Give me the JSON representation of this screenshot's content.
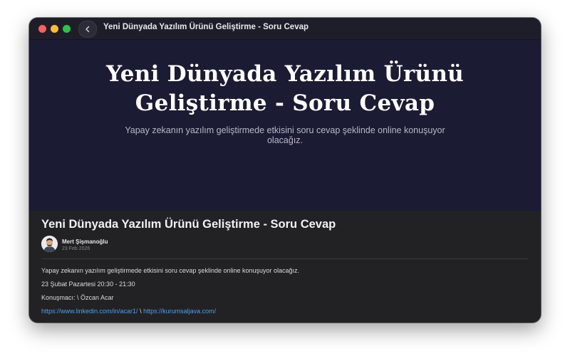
{
  "window": {
    "title": "Yeni Dünyada Yazılım Ürünü Geliştirme - Soru Cevap"
  },
  "hero": {
    "title_line1": "Yeni Dünyada Yazılım Ürünü",
    "title_line2": "Geliştirme - Soru Cevap",
    "subtitle": "Yapay zekanın yazılım geliştirmede etkisini soru cevap şeklinde online konuşuyor olacağız."
  },
  "post": {
    "title": "Yeni Dünyada Yazılım Ürünü Geliştirme - Soru Cevap",
    "author": "Mert Şişmanoğlu",
    "date": "23 Feb 2026",
    "paragraphs": [
      "Yapay zekanın yazılım geliştirmede etkisini soru cevap şeklinde online konuşuyor olacağız.",
      "23 Şubat Pazartesi 20:30 - 21:30",
      "Konuşmacı: \\ Özcan Acar"
    ],
    "links": {
      "linkedin": "https://www.linkedin.com/in/acar1/",
      "separator": " \\ ",
      "website": "https://kurumsaljava.com/"
    }
  },
  "icons": {
    "back": "chevron-left-icon"
  },
  "colors": {
    "hero_bg": "#1b1b33",
    "content_bg": "#222224",
    "link": "#4a9ff5"
  }
}
